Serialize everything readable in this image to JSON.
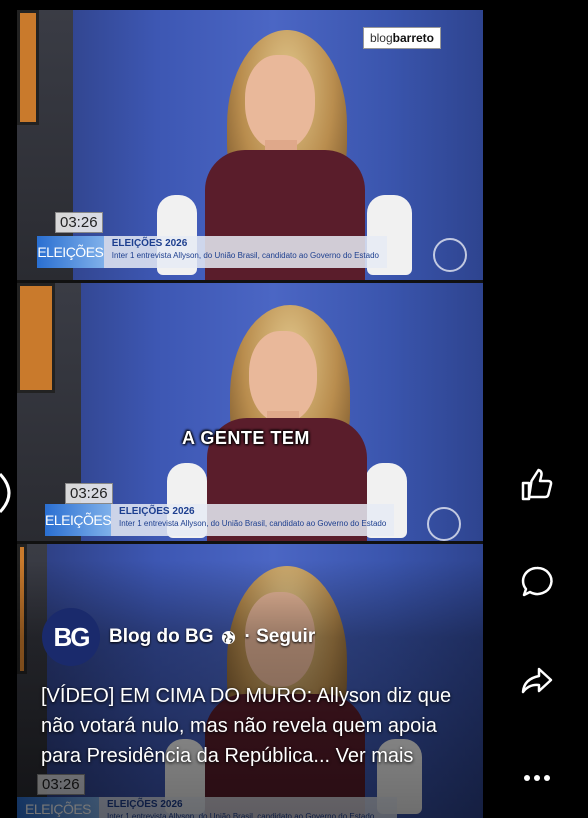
{
  "video": {
    "watermark_prefix": "blog",
    "watermark_brand": "barreto",
    "timer": "03:26",
    "lower_third_tag": "ELEIÇÕES",
    "lower_third_title": "ELEIÇÕES 2026",
    "lower_third_subtitle": "Inter 1 entrevista Allyson, do União Brasil, candidato ao Governo do Estado",
    "caption": "A GENTE TEM"
  },
  "post": {
    "avatar_text": "BG",
    "author": "Blog do BG",
    "separator_follow": "· Seguir",
    "description": "[VÍDEO] EM CIMA DO MURO: Allyson diz que não votará nulo, mas não revela quem apoia para Presidência da República...",
    "more": "Ver mais"
  },
  "actions": {
    "like_icon": "thumbs-up-icon",
    "comment_icon": "comment-icon",
    "share_icon": "share-icon",
    "more_icon": "more-icon"
  },
  "colors": {
    "background": "#000000",
    "avatar_bg": "#1a2a6c",
    "studio_blue": "#4b66c4",
    "lower_third_blue": "#2a6fd1"
  }
}
